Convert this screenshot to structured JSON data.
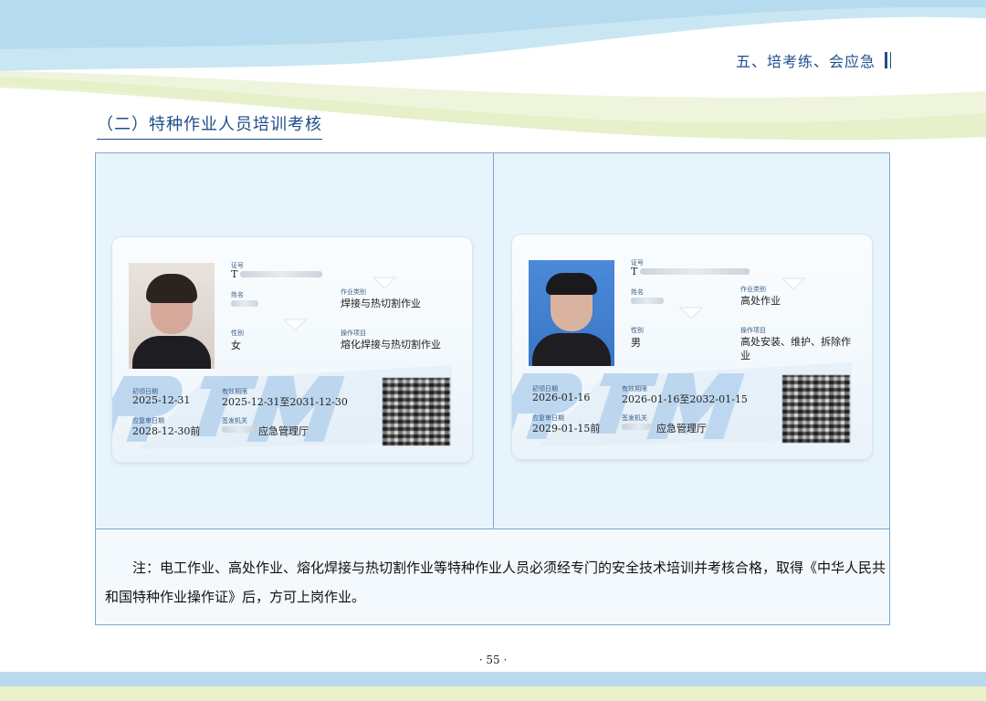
{
  "header": {
    "section": "五、培考练、会应急"
  },
  "section_title": "（二）特种作业人员培训考核",
  "cards": [
    {
      "id_label": "证号",
      "id_value": "T",
      "name_label": "姓名",
      "gender_label": "性别",
      "gender_value": "女",
      "category_label": "作业类别",
      "category_value": "焊接与热切割作业",
      "item_label": "操作项目",
      "item_value": "熔化焊接与热切割作业",
      "first_date_label": "初领日期",
      "first_date_value": "2025-12-31",
      "validity_label": "有效期限",
      "validity_value": "2025-12-31至2031-12-30",
      "review_label": "应复审日期",
      "review_value": "2028-12-30前",
      "issuer_label": "签发机关",
      "issuer_value": "应急管理厅",
      "photo_bg": "#ddd4cc"
    },
    {
      "id_label": "证号",
      "id_value": "T",
      "name_label": "姓名",
      "gender_label": "性别",
      "gender_value": "男",
      "category_label": "作业类别",
      "category_value": "高处作业",
      "item_label": "操作项目",
      "item_value_line1": "高处安装、维护、拆除作",
      "item_value_line2": "业",
      "first_date_label": "初领日期",
      "first_date_value": "2026-01-16",
      "validity_label": "有效期限",
      "validity_value": "2026-01-16至2032-01-15",
      "review_label": "应复审日期",
      "review_value": "2029-01-15前",
      "issuer_label": "签发机关",
      "issuer_value": "应急管理厅",
      "photo_bg": "#4a8ad8"
    }
  ],
  "note": "注：电工作业、高处作业、熔化焊接与热切割作业等特种作业人员必须经专门的安全技术培训并考核合格，取得《中华人民共和国特种作业操作证》后，方可上岗作业。",
  "page_number": "· 55 ·",
  "colors": {
    "title_blue": "#1f4e8c",
    "frame_border": "#7ea7cf",
    "frame_fill": "#e8f4fc",
    "card_logo": "#b8d4ee",
    "footer_blue": "#b9d9ec",
    "footer_green": "#e8f1c8"
  }
}
